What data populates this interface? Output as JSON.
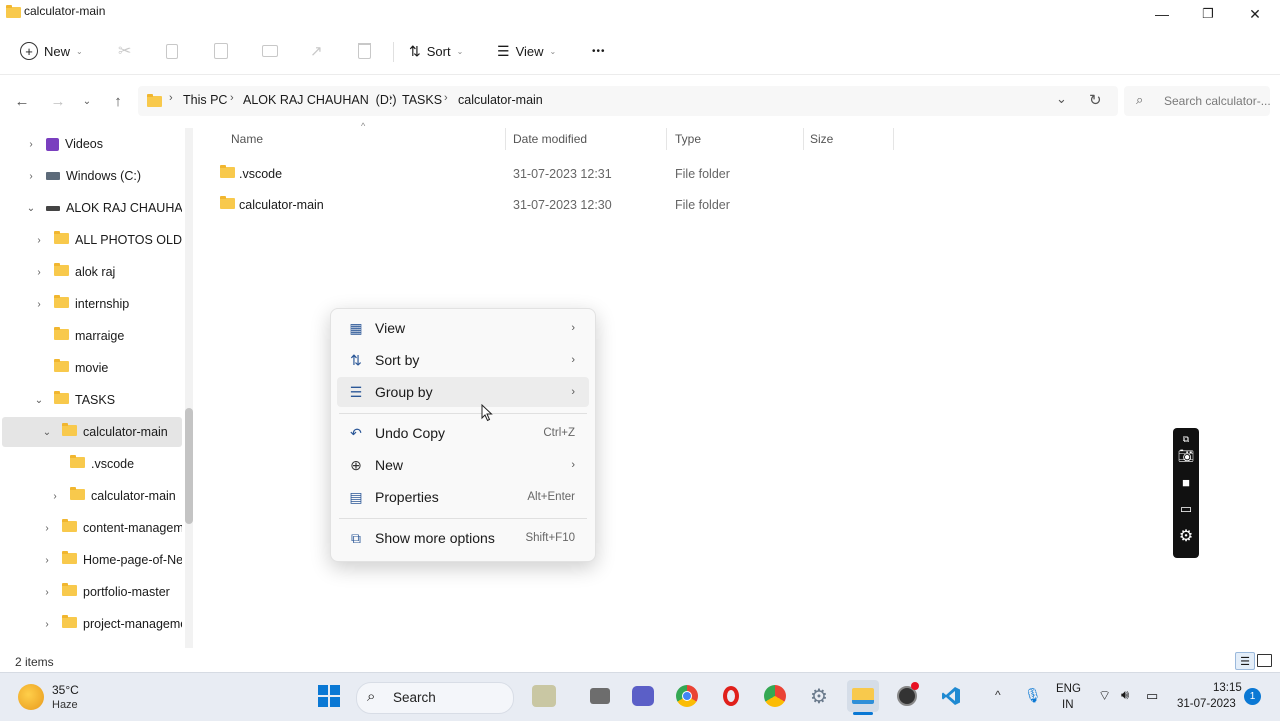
{
  "window": {
    "title": "calculator-main",
    "minimize": "—",
    "maximize": "❐",
    "close": "✕"
  },
  "toolbar": {
    "new_label": "New",
    "sort_label": "Sort",
    "view_label": "View",
    "more_label": "•••"
  },
  "address": {
    "crumbs": [
      "This PC",
      "ALOK RAJ CHAUHAN  (D:)",
      "TASKS",
      "calculator-main"
    ],
    "search_placeholder": "Search calculator-..."
  },
  "sidebar": {
    "items": [
      {
        "label": "Videos",
        "indent": 0,
        "chevron": ">"
      },
      {
        "label": "Windows (C:)",
        "indent": 0,
        "chevron": ">"
      },
      {
        "label": "ALOK RAJ CHAUHAN",
        "indent": 0,
        "chevron": "v"
      },
      {
        "label": "ALL PHOTOS OLD",
        "indent": 1,
        "chevron": ">"
      },
      {
        "label": "alok raj",
        "indent": 1,
        "chevron": ">"
      },
      {
        "label": "internship",
        "indent": 1,
        "chevron": ">"
      },
      {
        "label": "marraige",
        "indent": 1,
        "chevron": ""
      },
      {
        "label": "movie",
        "indent": 1,
        "chevron": ""
      },
      {
        "label": "TASKS",
        "indent": 1,
        "chevron": "v"
      },
      {
        "label": "calculator-main",
        "indent": 2,
        "chevron": "v",
        "selected": true
      },
      {
        "label": ".vscode",
        "indent": 3,
        "chevron": ""
      },
      {
        "label": "calculator-main",
        "indent": 3,
        "chevron": ">"
      },
      {
        "label": "content-managem",
        "indent": 2,
        "chevron": ">"
      },
      {
        "label": "Home-page-of-Ne",
        "indent": 2,
        "chevron": ">"
      },
      {
        "label": "portfolio-master",
        "indent": 2,
        "chevron": ">"
      },
      {
        "label": "project-manageme",
        "indent": 2,
        "chevron": ">"
      }
    ]
  },
  "columns": {
    "name": "Name",
    "date": "Date modified",
    "type": "Type",
    "size": "Size"
  },
  "files": [
    {
      "name": ".vscode",
      "date": "31-07-2023 12:31",
      "type": "File folder",
      "size": ""
    },
    {
      "name": "calculator-main",
      "date": "31-07-2023 12:30",
      "type": "File folder",
      "size": ""
    }
  ],
  "context_menu": {
    "items": [
      {
        "label": "View",
        "shortcut": "",
        "submenu": true
      },
      {
        "label": "Sort by",
        "shortcut": "",
        "submenu": true
      },
      {
        "label": "Group by",
        "shortcut": "",
        "submenu": true
      },
      {
        "label": "Undo Copy",
        "shortcut": "Ctrl+Z",
        "submenu": false
      },
      {
        "label": "New",
        "shortcut": "",
        "submenu": true
      },
      {
        "label": "Properties",
        "shortcut": "Alt+Enter",
        "submenu": false
      },
      {
        "label": "Show more options",
        "shortcut": "Shift+F10",
        "submenu": false
      }
    ]
  },
  "status": {
    "item_count": "2 items"
  },
  "taskbar": {
    "weather_temp": "35°C",
    "weather_desc": "Haze",
    "search_label": "Search",
    "lang_line1": "ENG",
    "lang_line2": "IN",
    "time": "13:15",
    "date": "31-07-2023",
    "notification_count": "1"
  }
}
